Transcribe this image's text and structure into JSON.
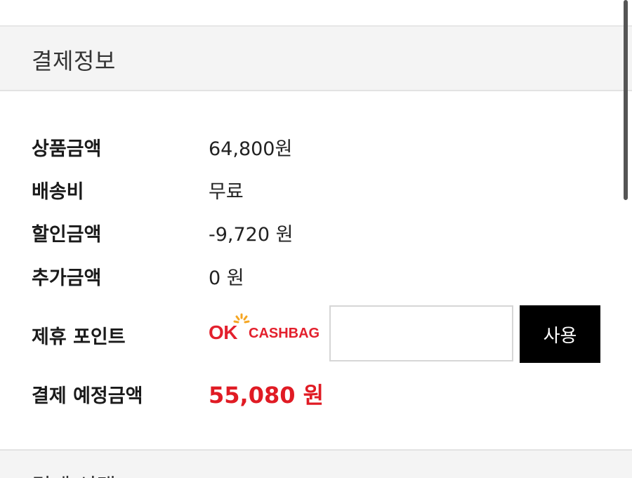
{
  "section": {
    "title": "결제정보"
  },
  "rows": {
    "product_amount": {
      "label": "상품금액",
      "value": "64,800원"
    },
    "shipping": {
      "label": "배송비",
      "value": "무료"
    },
    "discount": {
      "label": "할인금액",
      "value": "-9,720 원"
    },
    "extra": {
      "label": "추가금액",
      "value": "0 원"
    },
    "partner_points": {
      "label": "제휴 포인트",
      "logo_ok": "OK",
      "logo_cashbag": "CASHBAG",
      "input_value": "",
      "use_button": "사용"
    },
    "total": {
      "label": "결제 예정금액",
      "value": "55,080 원"
    }
  },
  "next_section": {
    "title": "결제 선택"
  },
  "colors": {
    "accent_red": "#e01b24",
    "button_black": "#000000",
    "header_bg": "#f4f4f4"
  }
}
